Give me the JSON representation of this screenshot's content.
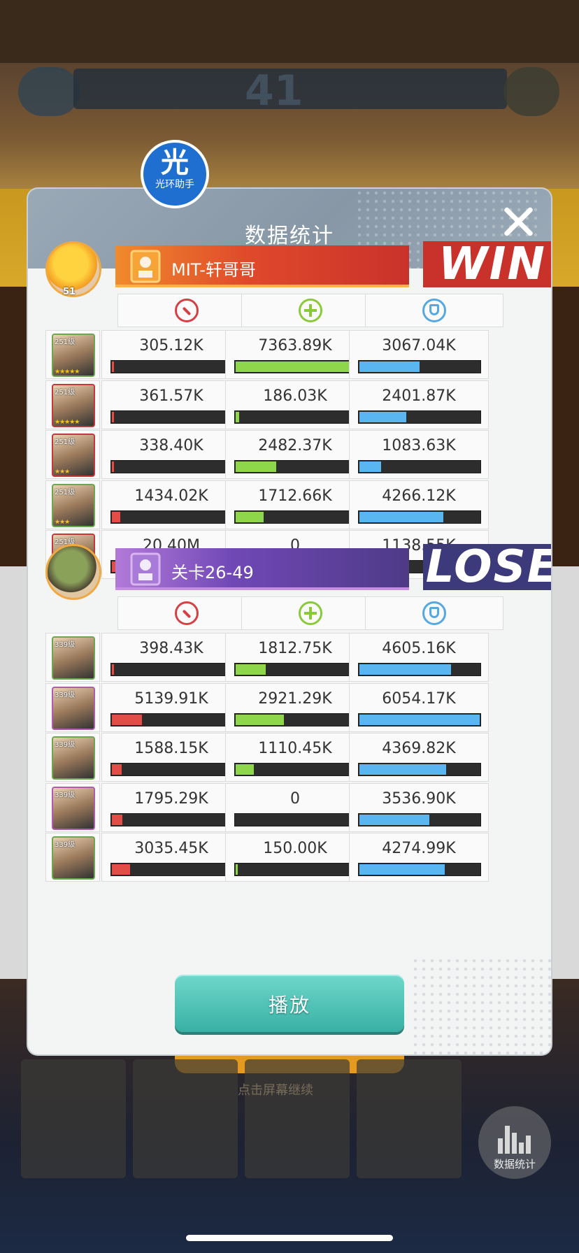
{
  "background": {
    "stage_number": "41",
    "hint_text": "点击屏幕继续",
    "stats_button_label": "数据统计"
  },
  "logo": {
    "glyph": "光",
    "label": "光环助手"
  },
  "modal": {
    "title": "数据统计",
    "play_label": "播放"
  },
  "teams": [
    {
      "name": "MIT-轩哥哥",
      "result": "WIN",
      "avatar_level": "51",
      "heroes": [
        {
          "level": "251级",
          "stars": "★★★★★",
          "frame": "g",
          "damage": "305.12K",
          "damage_pct": 0.02,
          "heal": "7363.89K",
          "heal_pct": 1.0,
          "tank": "3067.04K",
          "tank_pct": 0.5
        },
        {
          "level": "251级",
          "stars": "★★★★★",
          "frame": "r",
          "damage": "361.57K",
          "damage_pct": 0.02,
          "heal": "186.03K",
          "heal_pct": 0.03,
          "tank": "2401.87K",
          "tank_pct": 0.39
        },
        {
          "level": "251级",
          "stars": "★★★",
          "frame": "r",
          "damage": "338.40K",
          "damage_pct": 0.02,
          "heal": "2482.37K",
          "heal_pct": 0.34,
          "tank": "1083.63K",
          "tank_pct": 0.18
        },
        {
          "level": "251级",
          "stars": "★★★",
          "frame": "g",
          "damage": "1434.02K",
          "damage_pct": 0.07,
          "heal": "1712.66K",
          "heal_pct": 0.23,
          "tank": "4266.12K",
          "tank_pct": 0.7
        },
        {
          "level": "251级",
          "stars": "★★★★★",
          "frame": "r",
          "damage": "20.40M",
          "damage_pct": 1.0,
          "heal": "0",
          "heal_pct": 0,
          "tank": "1138.55K",
          "tank_pct": 0.19
        }
      ]
    },
    {
      "name": "关卡26-49",
      "result": "LOSE",
      "avatar_level": "",
      "heroes": [
        {
          "level": "339级",
          "stars": "",
          "frame": "g",
          "damage": "398.43K",
          "damage_pct": 0.02,
          "heal": "1812.75K",
          "heal_pct": 0.25,
          "tank": "4605.16K",
          "tank_pct": 0.76
        },
        {
          "level": "339级",
          "stars": "",
          "frame": "p",
          "damage": "5139.91K",
          "damage_pct": 0.25,
          "heal": "2921.29K",
          "heal_pct": 0.4,
          "tank": "6054.17K",
          "tank_pct": 1.0
        },
        {
          "level": "339级",
          "stars": "",
          "frame": "g",
          "damage": "1588.15K",
          "damage_pct": 0.08,
          "heal": "1110.45K",
          "heal_pct": 0.15,
          "tank": "4369.82K",
          "tank_pct": 0.72
        },
        {
          "level": "339级",
          "stars": "",
          "frame": "p",
          "damage": "1795.29K",
          "damage_pct": 0.09,
          "heal": "0",
          "heal_pct": 0,
          "tank": "3536.90K",
          "tank_pct": 0.58
        },
        {
          "level": "339级",
          "stars": "",
          "frame": "g",
          "damage": "3035.45K",
          "damage_pct": 0.15,
          "heal": "150.00K",
          "heal_pct": 0.02,
          "tank": "4274.99K",
          "tank_pct": 0.71
        }
      ]
    }
  ],
  "colors": {
    "damage": "#e24d48",
    "heal": "#8fd74a",
    "tank": "#5ab6f0",
    "win": "#c9322a",
    "lose": "#3c3a7a",
    "play_button": "#39b0a4"
  },
  "icons": {
    "damage": "sword-icon",
    "heal": "plus-icon",
    "tank": "shield-icon"
  }
}
